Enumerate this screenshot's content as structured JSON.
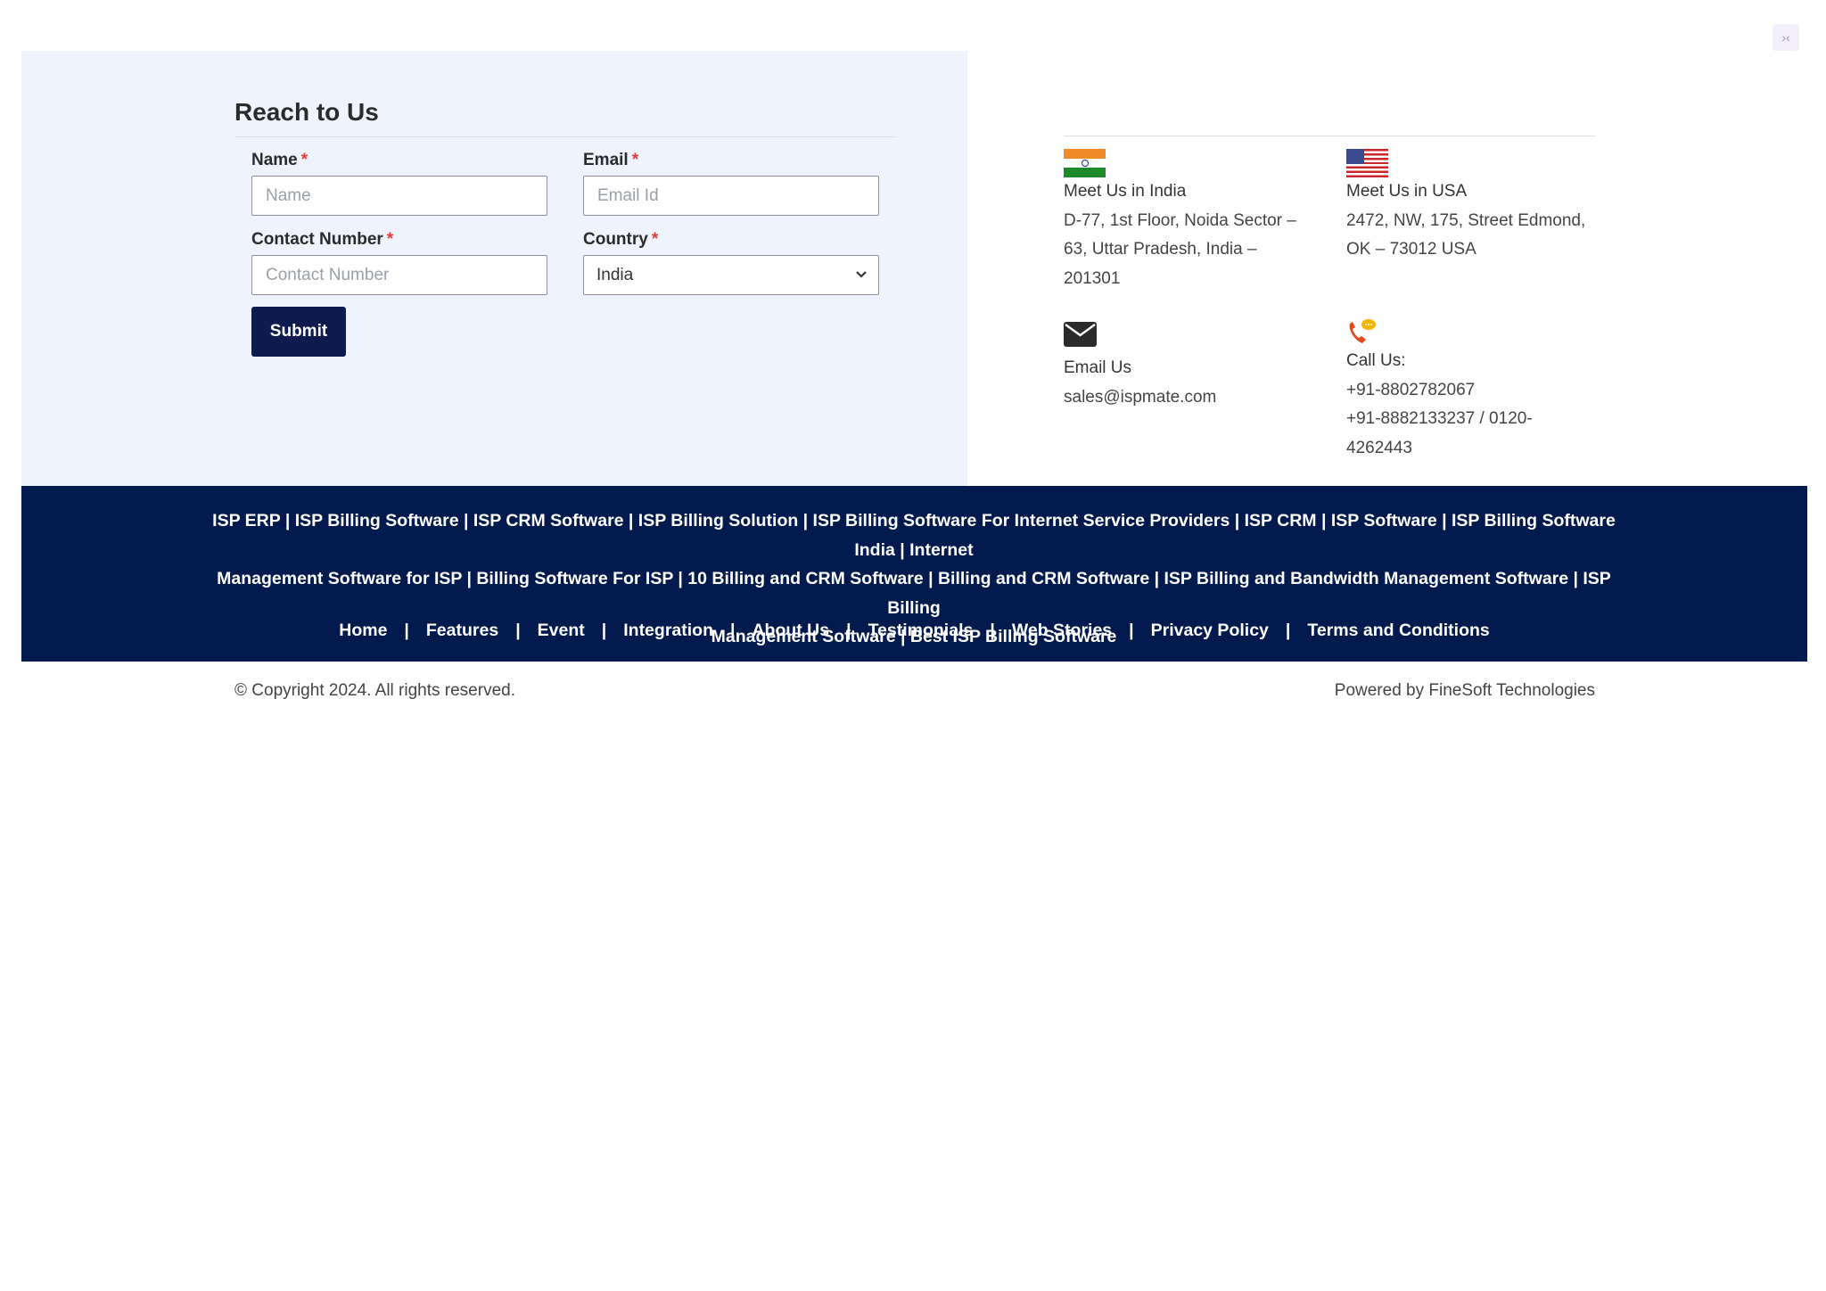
{
  "widget": {
    "icon": "code-icon",
    "glyph": "›‹"
  },
  "form": {
    "title": "Reach to Us",
    "name": {
      "label": "Name",
      "placeholder": "Name",
      "required_mark": "*"
    },
    "email": {
      "label": "Email",
      "placeholder": "Email Id",
      "required_mark": "*"
    },
    "contact": {
      "label": "Contact Number",
      "placeholder": "Contact Number",
      "required_mark": "*"
    },
    "country": {
      "label": "Country",
      "value": "India",
      "required_mark": "*"
    },
    "submit_label": "Submit"
  },
  "info": {
    "india": {
      "flag_icon": "india-flag-icon",
      "heading": "Meet Us in India",
      "line1": "D-77, 1st Floor, Noida Sector –",
      "line2": "63, Uttar Pradesh, India –",
      "line3": "201301"
    },
    "usa": {
      "flag_icon": "usa-flag-icon",
      "heading": "Meet Us in USA",
      "line1": "2472, NW, 175, Street Edmond,",
      "line2": "OK – 73012 USA"
    },
    "email": {
      "icon": "envelope-icon",
      "heading": "Email Us",
      "value": "sales@ispmate.com"
    },
    "call": {
      "icon": "phone-icon",
      "heading": "Call Us:",
      "line1": "+91-8802782067",
      "line2": "+91-8882133237 / 0120-",
      "line3": "4262443"
    }
  },
  "footer": {
    "keywords_line1": "ISP ERP | ISP Billing Software | ISP CRM Software | ISP Billing Solution | ISP Billing Software For Internet Service Providers | ISP CRM | ISP Software | ISP Billing Software India | Internet",
    "keywords_line2": "Management Software for ISP | Billing Software For ISP | 10 Billing and CRM Software | Billing and CRM Software | ISP Billing and Bandwidth Management Software | ISP Billing",
    "keywords_line3": "Management Software | Best ISP Billing Software",
    "nav": [
      "Home",
      "Features",
      "Event",
      "Integration",
      "About Us",
      "Testimonials",
      "Web Stories",
      "Privacy Policy",
      "Terms and Conditions"
    ],
    "separator": "|",
    "copyright": "© Copyright 2024. All rights reserved.",
    "powered_by": "Powered by FineSoft Technologies"
  },
  "colors": {
    "form_bg": "#eef3fd",
    "footer_bg": "#021a4d",
    "button_bg": "#0d1b4f",
    "required": "#e53935"
  }
}
